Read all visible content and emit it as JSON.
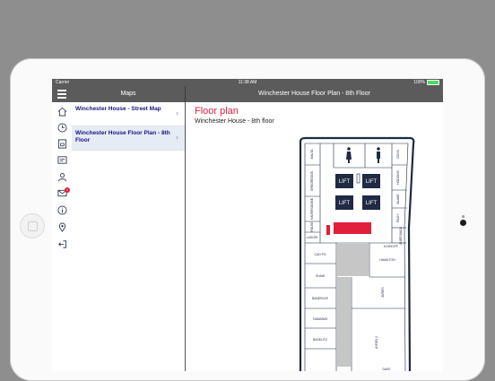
{
  "statusbar": {
    "carrier": "Carrier",
    "time": "11:38 AM",
    "battery": "100%",
    "battery_level": 1.0,
    "battery_color": "#4cd964"
  },
  "navbar": {
    "left_title": "Maps",
    "right_title": "Winchester House Floor Plan - 8th Floor"
  },
  "sidebar_icons": [
    "home-icon",
    "clock-icon",
    "coffee-machine-icon",
    "id-card-icon",
    "contacts-icon",
    "mail-icon",
    "info-icon",
    "location-pin-icon",
    "logout-icon"
  ],
  "notifications": {
    "mail_badge": "1"
  },
  "maps": [
    {
      "label": "Winchester House - Street Map",
      "selected": false
    },
    {
      "label": "Winchester House Floor Plan - 8th Floor",
      "selected": true
    }
  ],
  "detail": {
    "title": "Floor plan",
    "subtitle": "Winchester House - 8th floor"
  },
  "floorplan": {
    "lifts": [
      "LIFT",
      "LIFT",
      "LIFT",
      "LIFT"
    ],
    "rooms_left": [
      "MALTA",
      "GREGREGOS",
      "HAVERSOOME",
      "POLKE",
      "LAGORI",
      "CAD PO",
      "SHAW",
      "BANERLEE",
      "TABAMMO",
      "BASELITZ"
    ],
    "rooms_right": [
      "GOYA",
      "HODGKIN",
      "BLAKE",
      "RILEY",
      "AUER BACH",
      "KOSSOFF",
      "HAMILTON",
      "AVRES",
      "AYRES 2",
      "DAVE"
    ],
    "colors": {
      "wall": "#1f2a44",
      "lift": "#1f2a44",
      "accent": "#e01f3d",
      "void": "#c6c6c6"
    }
  }
}
